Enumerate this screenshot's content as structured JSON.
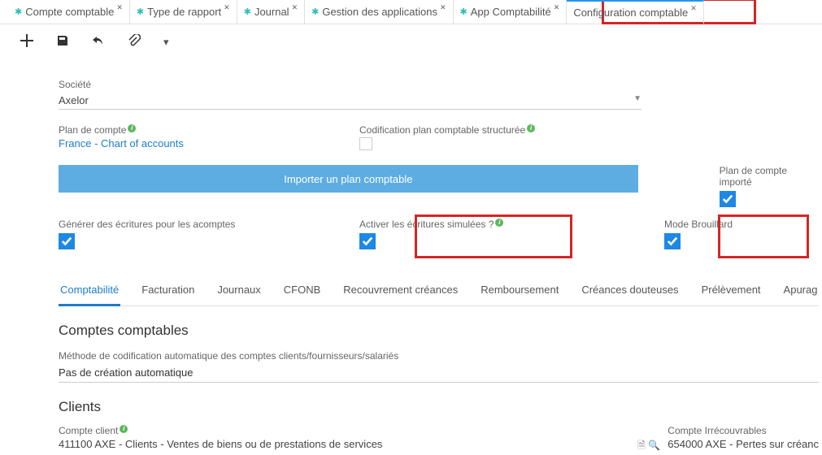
{
  "tabs": [
    {
      "label": "Compte comptable"
    },
    {
      "label": "Type de rapport"
    },
    {
      "label": "Journal"
    },
    {
      "label": "Gestion des applications"
    },
    {
      "label": "App Comptabilité"
    },
    {
      "label": "Configuration comptable"
    }
  ],
  "fields": {
    "societe_label": "Société",
    "societe_value": "Axelor",
    "plan_label": "Plan de compte",
    "plan_value": "France - Chart of accounts",
    "codif_label": "Codification plan comptable structurée",
    "importe_label": "Plan de compte importé",
    "import_btn": "Importer un plan comptable",
    "gen_label": "Générer des écritures pour les acomptes",
    "sim_label": "Activer les écritures simulées ?",
    "brou_label": "Mode Brouillard"
  },
  "subtabs": [
    "Comptabilité",
    "Facturation",
    "Journaux",
    "CFONB",
    "Recouvrement créances",
    "Remboursement",
    "Créances douteuses",
    "Prélèvement",
    "Apurag"
  ],
  "sections": {
    "comptes_h": "Comptes comptables",
    "methode_label": "Méthode de codification automatique des comptes clients/fournisseurs/salariés",
    "methode_value": "Pas de création automatique",
    "clients_h": "Clients",
    "compte_client_label": "Compte client",
    "compte_client_value": "411100  AXE - Clients - Ventes de biens ou de prestations de services",
    "irrec_label": "Compte Irrécouvrables",
    "irrec_value": "654000  AXE - Pertes sur créanc"
  }
}
